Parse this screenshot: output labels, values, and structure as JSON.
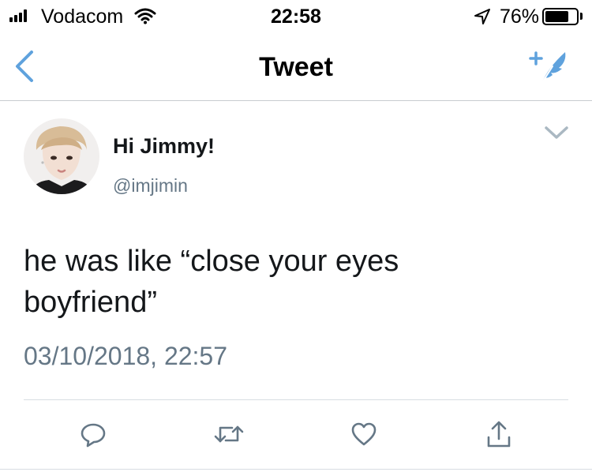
{
  "status_bar": {
    "carrier": "Vodacom",
    "time": "22:58",
    "battery_percent": "76%",
    "battery_level": 0.76,
    "signal_bars": 4
  },
  "nav": {
    "title": "Tweet",
    "back_icon": "chevron-left-icon",
    "compose_icon": "compose-feather-icon",
    "accent_color": "#5fa2dd"
  },
  "tweet": {
    "display_name": "Hi Jimmy!",
    "handle": "@imjimin",
    "text_line1": "he was like “close your eyes",
    "text_line2": "boyfriend”",
    "timestamp": "03/10/2018, 22:57",
    "caret_icon": "chevron-down-icon"
  },
  "actions": {
    "reply_icon": "reply-icon",
    "retweet_icon": "retweet-icon",
    "like_icon": "heart-icon",
    "share_icon": "share-icon",
    "icon_color": "#657786"
  }
}
